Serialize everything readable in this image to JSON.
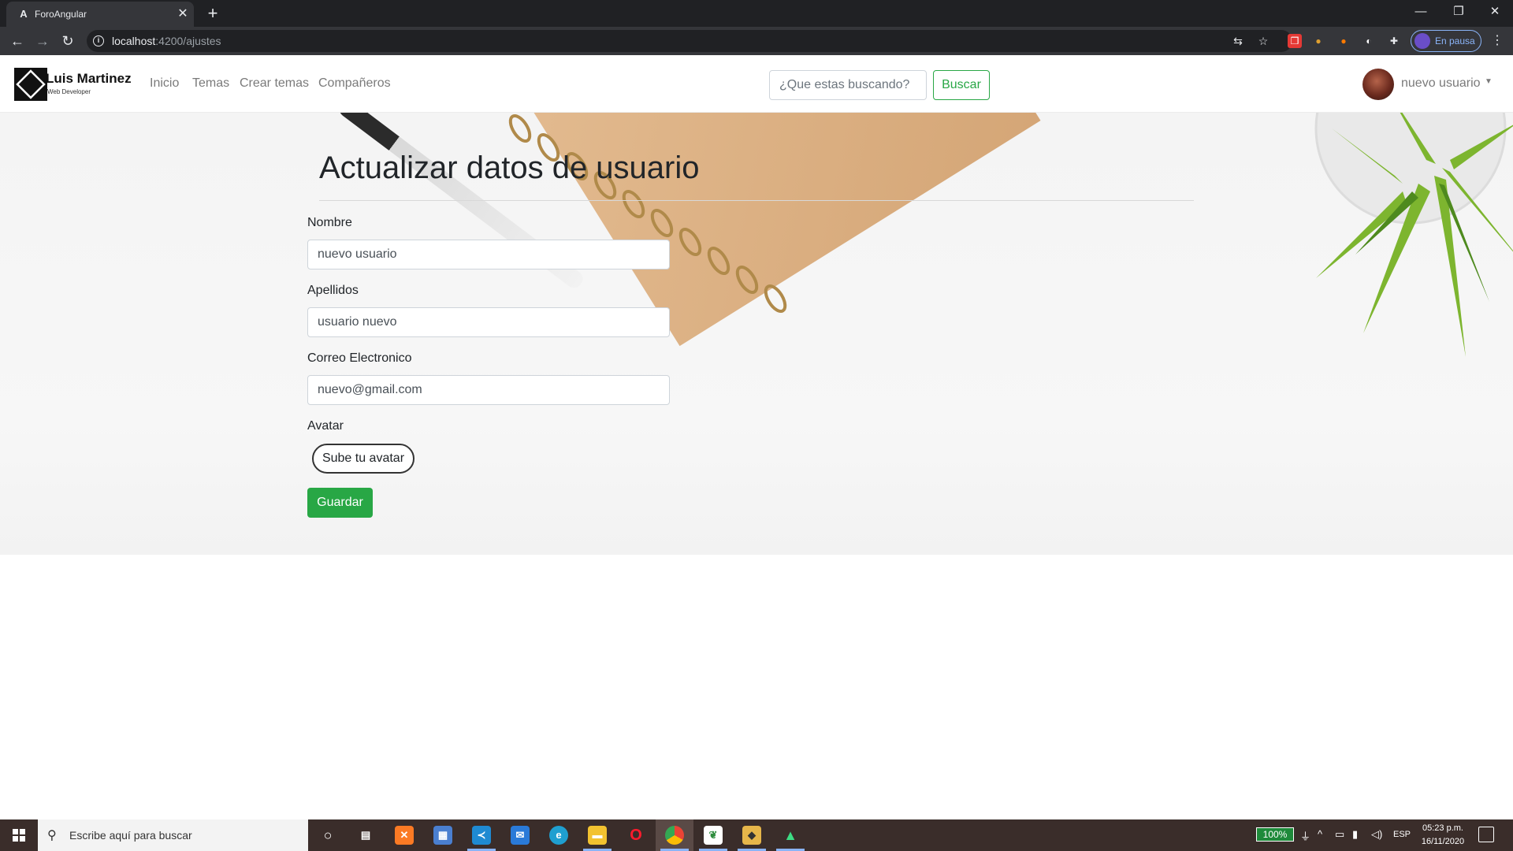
{
  "browser": {
    "tab_title": "ForoAngular",
    "tab_favicon": "A",
    "url_host": "localhost",
    "url_path": ":4200/ajustes",
    "profile_label": "En pausa"
  },
  "site": {
    "brand_name": "Luis Martinez",
    "brand_tagline": "Web Developer",
    "nav": [
      {
        "label": "Inicio"
      },
      {
        "label": "Temas"
      },
      {
        "label": "Crear temas"
      },
      {
        "label": "Compañeros"
      }
    ],
    "search_placeholder": "¿Que estas buscando?",
    "search_button": "Buscar",
    "user_name": "nuevo usuario"
  },
  "form": {
    "title": "Actualizar datos de usuario",
    "nombre_label": "Nombre",
    "nombre_value": "nuevo usuario",
    "apellidos_label": "Apellidos",
    "apellidos_value": "usuario nuevo",
    "correo_label": "Correo Electronico",
    "correo_value": "nuevo@gmail.com",
    "avatar_label": "Avatar",
    "upload_button": "Sube tu avatar",
    "save_button": "Guardar"
  },
  "taskbar": {
    "search_placeholder": "Escribe aquí para buscar",
    "battery": "100%",
    "language": "ESP",
    "time": "05:23 p.m.",
    "date": "16/11/2020"
  },
  "colors": {
    "accent_green": "#28a745",
    "browser_dark": "#202124",
    "taskbar": "#3a2d2a"
  }
}
